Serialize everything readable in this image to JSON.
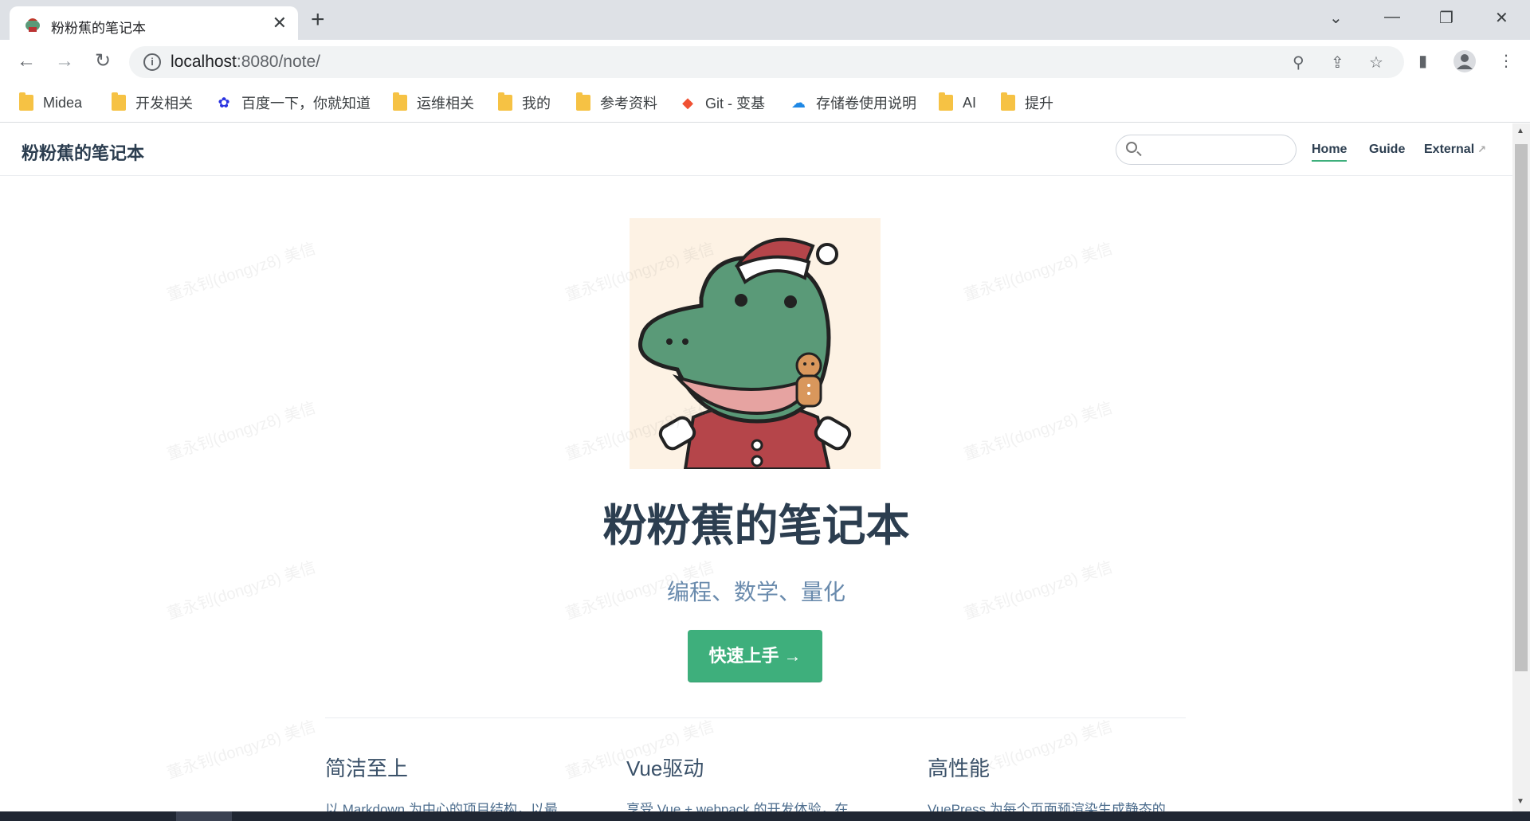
{
  "browser": {
    "tab_title": "粉粉蕉的笔记本",
    "tab_close": "✕",
    "new_tab": "+",
    "url_host": "localhost",
    "url_rest": ":8080/note/",
    "window_controls": {
      "dropdown": "⌄",
      "minimize": "—",
      "restore": "❐",
      "close": "✕"
    }
  },
  "bookmarks": [
    {
      "label": "Midea",
      "icon": "folder-icon"
    },
    {
      "label": "开发相关",
      "icon": "folder-icon"
    },
    {
      "label": "百度一下，你就知道",
      "icon": "baidu-paw-icon"
    },
    {
      "label": "运维相关",
      "icon": "folder-icon"
    },
    {
      "label": "我的",
      "icon": "folder-icon"
    },
    {
      "label": "参考资料",
      "icon": "folder-icon"
    },
    {
      "label": "Git - 变基",
      "icon": "git-icon"
    },
    {
      "label": "存储卷使用说明",
      "icon": "cloud-icon"
    },
    {
      "label": "AI",
      "icon": "folder-icon"
    },
    {
      "label": "提升",
      "icon": "folder-icon"
    }
  ],
  "site": {
    "name": "粉粉蕉的笔记本",
    "nav": [
      {
        "label": "Home"
      },
      {
        "label": "Guide"
      },
      {
        "label": "External"
      }
    ]
  },
  "hero": {
    "image_alt": "crocodile-santa-illustration",
    "title": "粉粉蕉的笔记本",
    "description": "编程、数学、量化",
    "action": "快速上手 →"
  },
  "features": [
    {
      "title": "简洁至上",
      "details": "以 Markdown 为中心的项目结构，以最"
    },
    {
      "title": "Vue驱动",
      "details": "享受 Vue + webpack 的开发体验，在"
    },
    {
      "title": "高性能",
      "details": "VuePress 为每个页面预渲染生成静态的"
    }
  ],
  "watermark": "董永钊(dongyz8) 美信",
  "colors": {
    "accent": "#3eaf7c",
    "text": "#2c3e50",
    "desc": "#6a8bad"
  }
}
